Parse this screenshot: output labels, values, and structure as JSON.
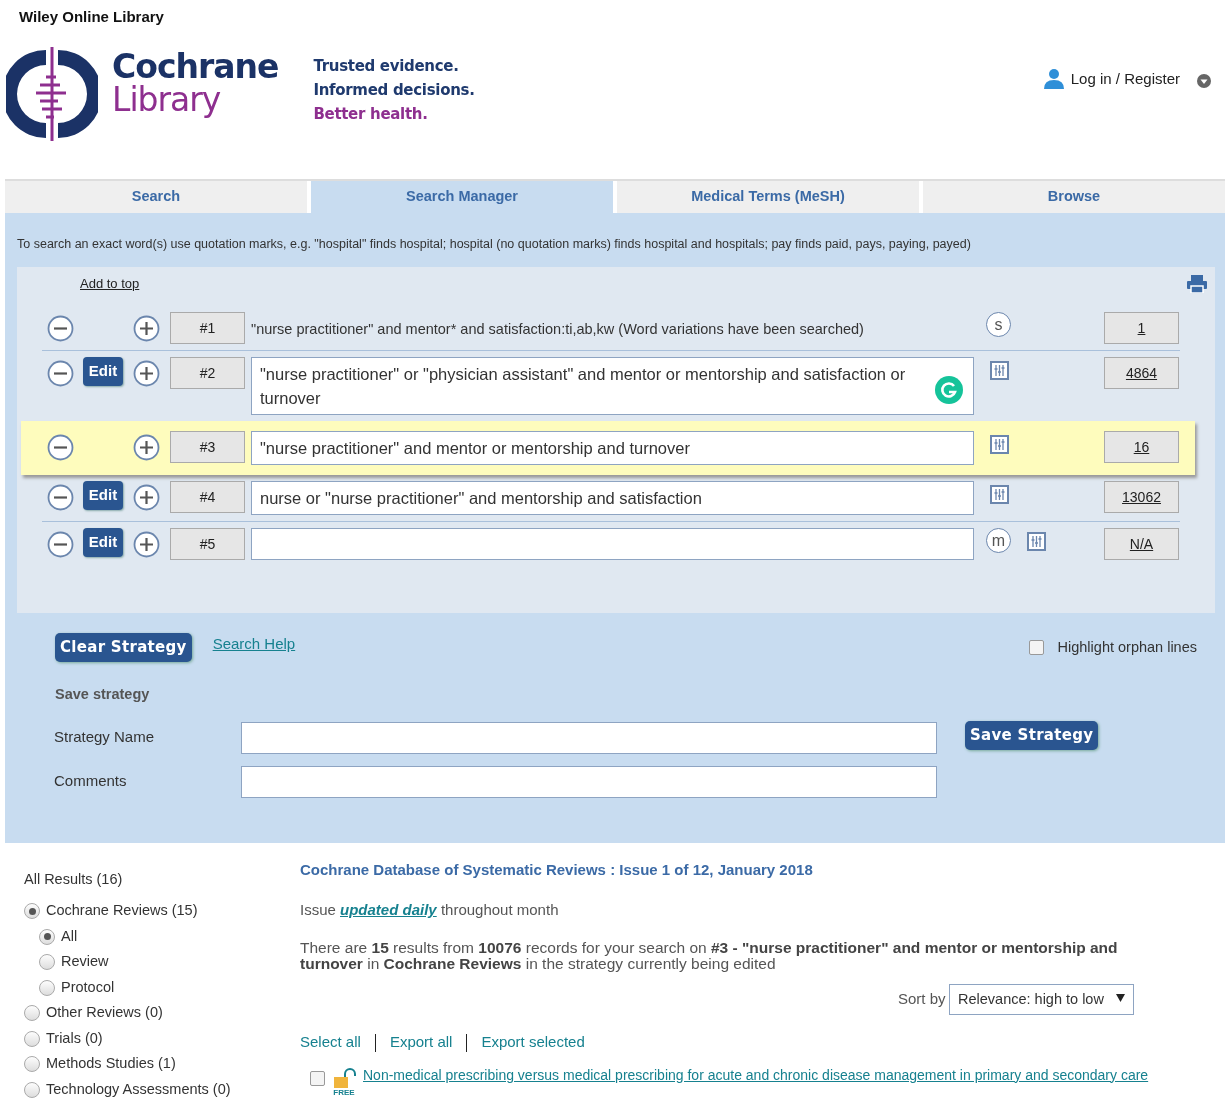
{
  "site_name": "Wiley Online Library",
  "logo": {
    "line1": "Cochrane",
    "line2": "Library"
  },
  "tagline": [
    {
      "text": "Trusted evidence.",
      "color": "#1f3a6e"
    },
    {
      "text": "Informed decisions.",
      "color": "#1f3a6e"
    },
    {
      "text": "Better health.",
      "color": "#8e2f8f"
    }
  ],
  "account": {
    "label": "Log in / Register"
  },
  "tabs": [
    {
      "label": "Search",
      "selected": false
    },
    {
      "label": "Search Manager",
      "selected": true
    },
    {
      "label": "Medical Terms (MeSH)",
      "selected": false
    },
    {
      "label": "Browse",
      "selected": false
    }
  ],
  "hint": "To search an exact word(s) use quotation marks, e.g. \"hospital\" finds hospital; hospital (no quotation marks) finds hospital and hospitals; pay finds paid, pays, paying, payed)",
  "strategy": {
    "add_to_top": "Add to top",
    "lines": [
      {
        "number": "#1",
        "kind": "text",
        "query": "\"nurse practitioner\" and mentor* and satisfaction:ti,ab,kw (Word variations have been searched)",
        "highlighted": false,
        "badge": "s",
        "limits": false,
        "grammar_check": false,
        "results": "1"
      },
      {
        "number": "#2",
        "kind": "field",
        "query": "\"nurse practitioner\" or \"physician assistant\" and mentor or mentorship and satisfaction or turnover",
        "edit_button": "Edit",
        "highlighted": false,
        "limits": true,
        "grammar_check": true,
        "results": "4864"
      },
      {
        "number": "#3",
        "kind": "field",
        "query": "\"nurse practitioner\" and mentor or mentorship and turnover",
        "highlighted": true,
        "limits": true,
        "grammar_check": false,
        "results": "16"
      },
      {
        "number": "#4",
        "kind": "field",
        "query": "nurse or \"nurse practitioner\" and mentorship and satisfaction",
        "edit_button": "Edit",
        "highlighted": false,
        "limits": true,
        "grammar_check": false,
        "results": "13062"
      },
      {
        "number": "#5",
        "kind": "field",
        "edit_button": "Edit",
        "highlighted": false,
        "badge": "m",
        "limits": true,
        "grammar_check": false,
        "results": "N/A"
      }
    ]
  },
  "clear_button": "Clear Strategy",
  "help_link": "Search Help",
  "orphan_lines": {
    "label": "Highlight orphan lines",
    "checked": false
  },
  "save": {
    "heading": "Save strategy",
    "fields": [
      {
        "label": "Strategy Name"
      },
      {
        "label": "Comments"
      }
    ],
    "button": "Save Strategy"
  },
  "facets": {
    "title": "All Results (16)",
    "items": [
      {
        "label": "Cochrane Reviews (15)",
        "selected": true,
        "children": [
          {
            "label": "All",
            "selected": true
          },
          {
            "label": "Review",
            "selected": false
          },
          {
            "label": "Protocol",
            "selected": false
          }
        ]
      },
      {
        "label": "Other Reviews (0)",
        "selected": false
      },
      {
        "label": "Trials (0)",
        "selected": false
      },
      {
        "label": "Methods Studies (1)",
        "selected": false
      },
      {
        "label": "Technology Assessments (0)",
        "selected": false
      }
    ]
  },
  "results": {
    "heading": "Cochrane Database of Systematic Reviews : Issue 1 of 12, January 2018",
    "issue": {
      "before": "Issue",
      "link": "updated daily",
      "after": "throughout month"
    },
    "summary": "There are **15** results from **10076** records for your search on **#3 - \"nurse practitioner\" and mentor or mentorship and turnover** in **Cochrane Reviews** in the strategy currently being edited",
    "sort": {
      "label": "Sort by",
      "value": "Relevance: high to low"
    },
    "actions": [
      "Select all",
      "Export all",
      "Export selected"
    ],
    "items": [
      {
        "title": "Non-medical prescribing versus medical prescribing for acute and chronic disease management in primary and secondary care",
        "checked": false,
        "free_label": "FREE"
      }
    ]
  }
}
